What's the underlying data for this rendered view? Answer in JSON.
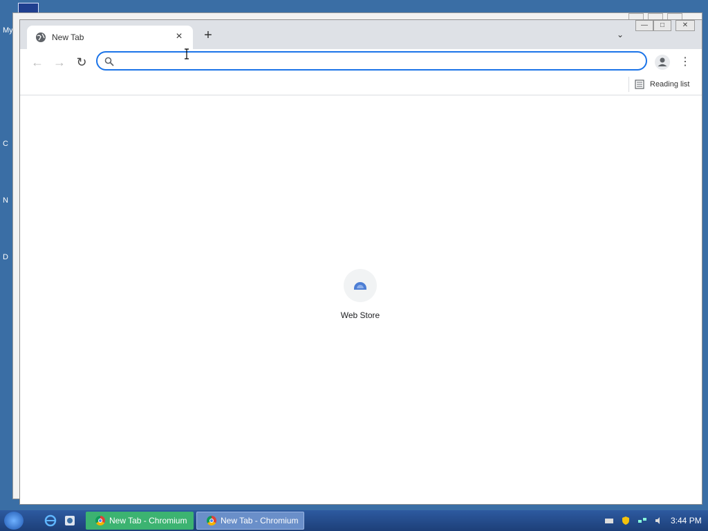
{
  "desktop": {
    "labels": [
      "My",
      "C",
      "N",
      "D"
    ]
  },
  "browser": {
    "tab": {
      "title": "New Tab",
      "close_symbol": "×"
    },
    "new_tab_symbol": "+",
    "tab_search_symbol": "⌄",
    "window_controls": {
      "minimize": "—",
      "maximize": "□",
      "close": "✕"
    },
    "toolbar": {
      "back_symbol": "←",
      "forward_symbol": "→",
      "reload_symbol": "↻",
      "omnibox": {
        "value": "",
        "placeholder": ""
      },
      "menu_symbol": "⋮"
    },
    "bookmarks": {
      "reading_list_label": "Reading list"
    },
    "ntp": {
      "shortcuts": [
        {
          "label": "Web Store",
          "icon": "web-store-icon"
        }
      ]
    }
  },
  "taskbar": {
    "tasks": [
      {
        "label": "New Tab - Chromium",
        "active": true
      },
      {
        "label": "New Tab - Chromium",
        "active": false
      }
    ],
    "clock": "3:44 PM"
  },
  "colors": {
    "accent": "#1a73e8",
    "desktop": "#3a6ea5",
    "task_active": "#3cb371",
    "task_inactive": "#6a8fc9"
  }
}
